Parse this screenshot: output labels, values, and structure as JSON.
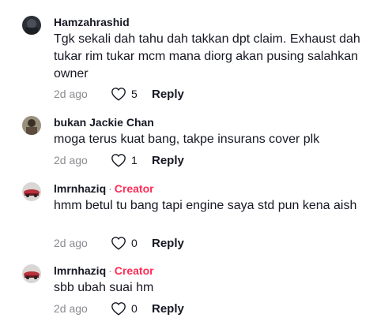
{
  "comments": [
    {
      "author": "Hamzahrashid",
      "is_creator": false,
      "creator_label": "",
      "text": "Tgk sekali dah tahu dah takkan dpt claim. Exhaust dah tukar rim tukar mcm mana diorg akan pusing salahkan owner",
      "age": "2d ago",
      "likes": "5",
      "reply_label": "Reply"
    },
    {
      "author": "bukan Jackie Chan",
      "is_creator": false,
      "creator_label": "",
      "text": "moga terus kuat bang, takpe insurans cover plk",
      "age": "2d ago",
      "likes": "1",
      "reply_label": "Reply"
    },
    {
      "author": "lmrnhaziq",
      "is_creator": true,
      "separator": "·",
      "creator_label": "Creator",
      "text": "hmm betul tu bang tapi engine saya std pun kena aish",
      "age": "2d ago",
      "likes": "0",
      "reply_label": "Reply"
    },
    {
      "author": "lmrnhaziq",
      "is_creator": true,
      "separator": "·",
      "creator_label": "Creator",
      "text": "sbb ubah suai hm",
      "age": "2d ago",
      "likes": "0",
      "reply_label": "Reply"
    }
  ],
  "colors": {
    "creator": "#fe2c55",
    "muted": "#8a8b91",
    "text": "#161823"
  },
  "icons": {
    "like": "heart-outline-icon"
  }
}
